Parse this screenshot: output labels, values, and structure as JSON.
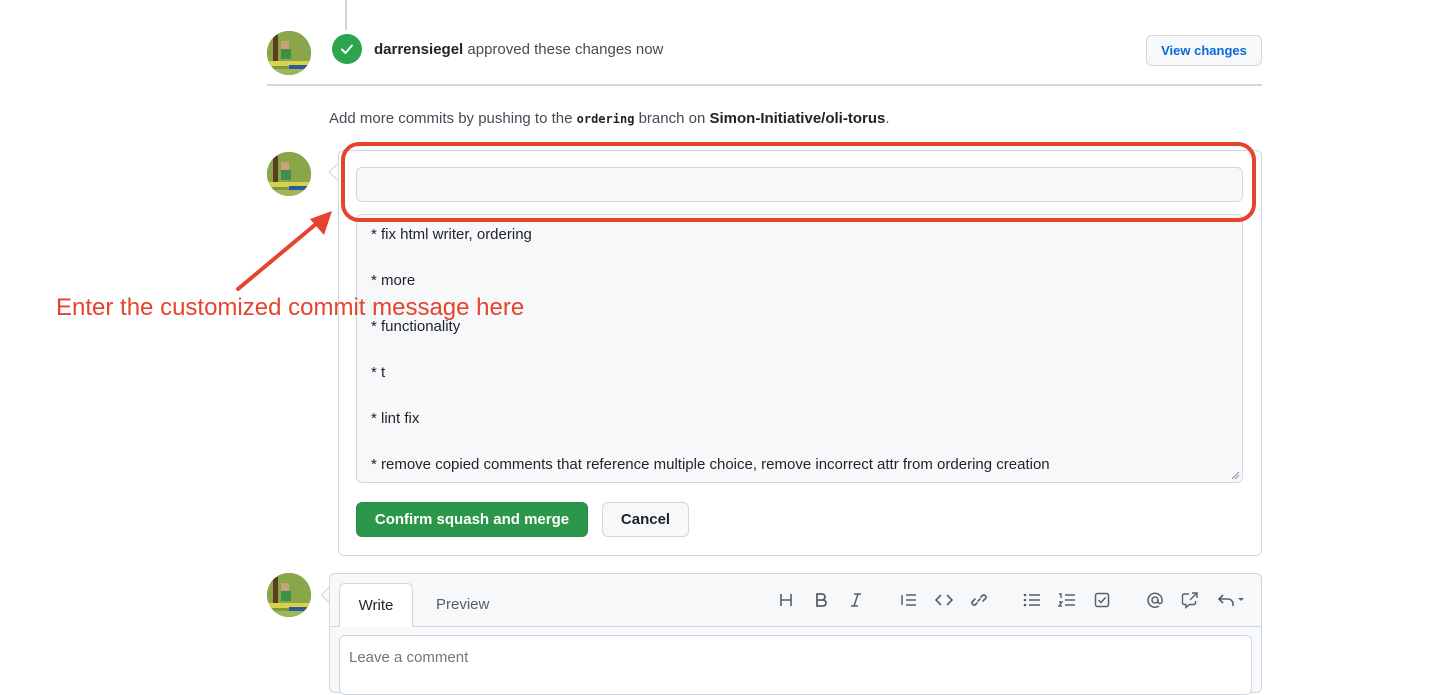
{
  "approval": {
    "user": "darrensiegel",
    "text": "approved these changes now",
    "view_changes_label": "View changes"
  },
  "branch_note": {
    "prefix": "Add more commits by pushing to the",
    "branch": "ordering",
    "middle": "branch on",
    "repo": "Simon-Initiative/oli-torus",
    "suffix": "."
  },
  "merge": {
    "title_value": "",
    "body_lines": [
      "* fix html writer, ordering",
      "* more",
      "* functionality",
      "* t",
      "* lint fix",
      "* remove copied comments that reference multiple choice, remove incorrect attr from ordering creation"
    ],
    "confirm_label": "Confirm squash and merge",
    "cancel_label": "Cancel"
  },
  "annotation": {
    "text": "Enter the customized commit message here",
    "color": "#e5432d"
  },
  "comment": {
    "tab_write": "Write",
    "tab_preview": "Preview",
    "placeholder": "Leave a comment",
    "toolbar_icons": [
      "heading-icon",
      "bold-icon",
      "italic-icon",
      "quote-icon",
      "code-icon",
      "link-icon",
      "unordered-list-icon",
      "ordered-list-icon",
      "task-list-icon",
      "mention-icon",
      "reference-icon",
      "reply-icon"
    ]
  },
  "colors": {
    "success_green": "#2c974b",
    "link_blue": "#0969da",
    "border": "#d0d7de"
  }
}
